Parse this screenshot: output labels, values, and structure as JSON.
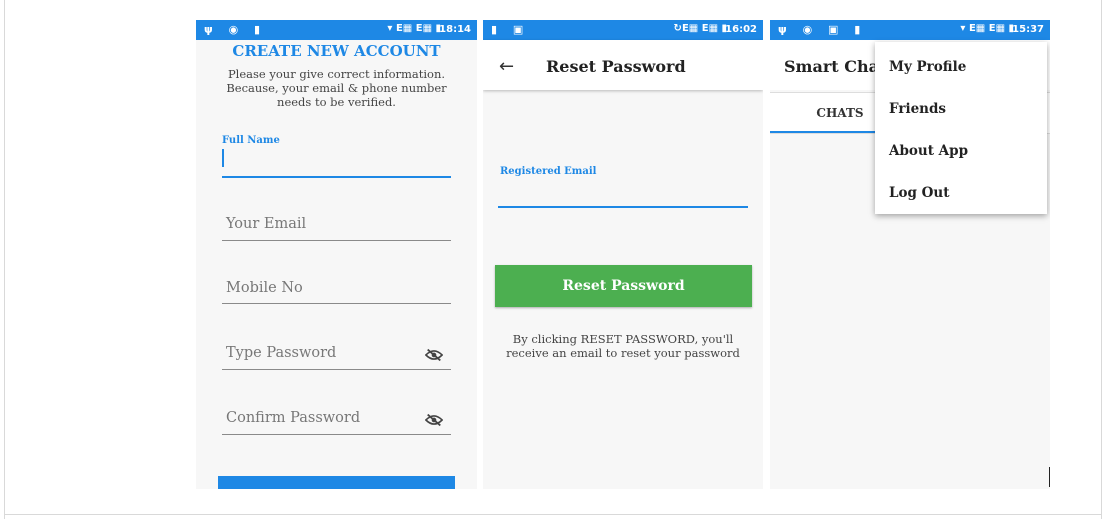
{
  "screens": {
    "register": {
      "status": {
        "time": "18:14",
        "network": "E"
      },
      "title": "CREATE NEW ACCOUNT",
      "description": "Please your give correct information. Because, your email & phone number needs to be verified.",
      "fields": [
        {
          "label": "Full Name",
          "value": ""
        },
        {
          "placeholder": "Your Email"
        },
        {
          "placeholder": "Mobile No"
        },
        {
          "placeholder": "Type Password",
          "icon": "eye-off-icon"
        },
        {
          "placeholder": "Confirm Password",
          "icon": "eye-off-icon"
        }
      ]
    },
    "reset": {
      "status": {
        "time": "16:02",
        "network": "E"
      },
      "title": "Reset Password",
      "email_label": "Registered Email",
      "button_label": "Reset Password",
      "note": "By clicking RESET PASSWORD, you'll receive an email to reset your password"
    },
    "chat": {
      "status": {
        "time": "15:37",
        "network": "E"
      },
      "title": "Smart Chat",
      "tabs": [
        "CHATS"
      ],
      "menu": [
        "My Profile",
        "Friends",
        "About App",
        "Log Out"
      ]
    }
  },
  "colors": {
    "accent": "#1e88e5",
    "button_green": "#4caf50"
  }
}
